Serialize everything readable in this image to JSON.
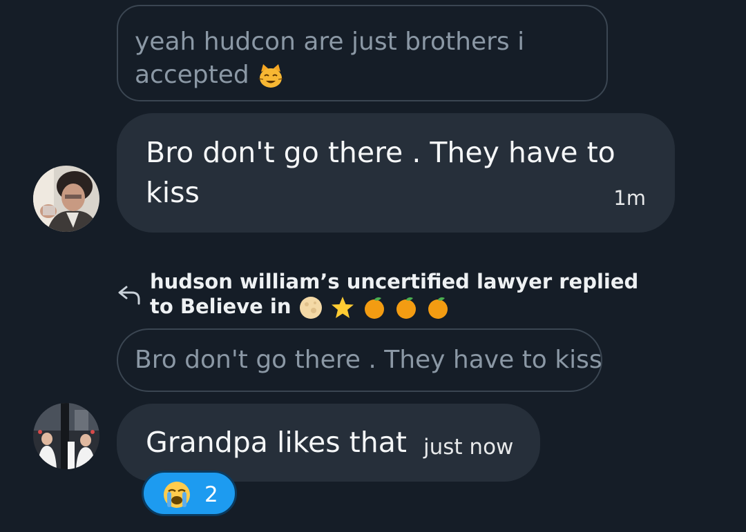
{
  "messages": [
    {
      "quoted_text": "yeah hudcon are just brothers i accepted",
      "quoted_emoji": "grinning-cat-emoji",
      "text": "Bro don't go there . They have to kiss",
      "time": "1m",
      "avatar": "man-in-suit-avatar"
    },
    {
      "reply_header": "hudson william’s uncertified lawyer replied to Believe in",
      "reply_header_emojis": [
        "full-moon-emoji",
        "star-emoji",
        "tangerine-emoji",
        "tangerine-emoji",
        "tangerine-emoji"
      ],
      "quoted_text": "Bro don't go there . They have to kiss",
      "text": "Grandpa likes that",
      "time": "just now",
      "avatar": "street-group-photo-avatar",
      "reaction": {
        "emoji": "loudly-crying-face-emoji",
        "count": "2"
      }
    }
  ],
  "colors": {
    "background": "#151d27",
    "bubble": "#262f3a",
    "quote_border": "#3b4652",
    "quote_text": "#8b98a5",
    "reaction_bg": "#1d9bf0"
  }
}
